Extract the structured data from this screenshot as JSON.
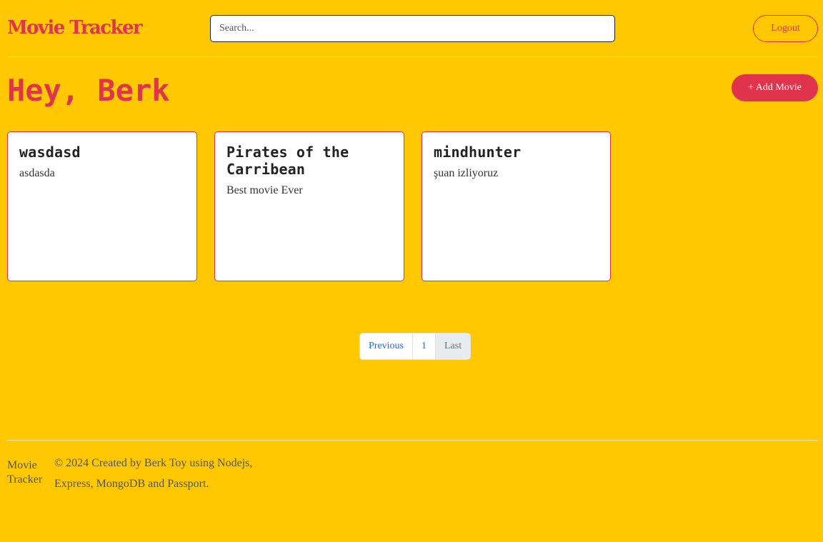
{
  "header": {
    "brand": "Movie Tracker",
    "search_placeholder": "Search...",
    "search_value": "",
    "logout_label": "Logout"
  },
  "main": {
    "greeting": "Hey, Berk",
    "add_movie_label": "+ Add Movie",
    "movies": [
      {
        "title": "wasdasd",
        "description": "asdasda"
      },
      {
        "title": "Pirates of the Carribean",
        "description": "Best movie Ever"
      },
      {
        "title": "mindhunter",
        "description": "şuan izliyoruz"
      }
    ]
  },
  "pagination": {
    "previous_label": "Previous",
    "page_label": "1",
    "last_label": "Last"
  },
  "footer": {
    "brand": "Movie Tracker",
    "copyright": "© 2024 Created by Berk Toy using Nodejs, Express, MongoDB and Passport."
  },
  "colors": {
    "background": "#ffc800",
    "accent": "#e0344c",
    "link": "#0d6efd"
  }
}
